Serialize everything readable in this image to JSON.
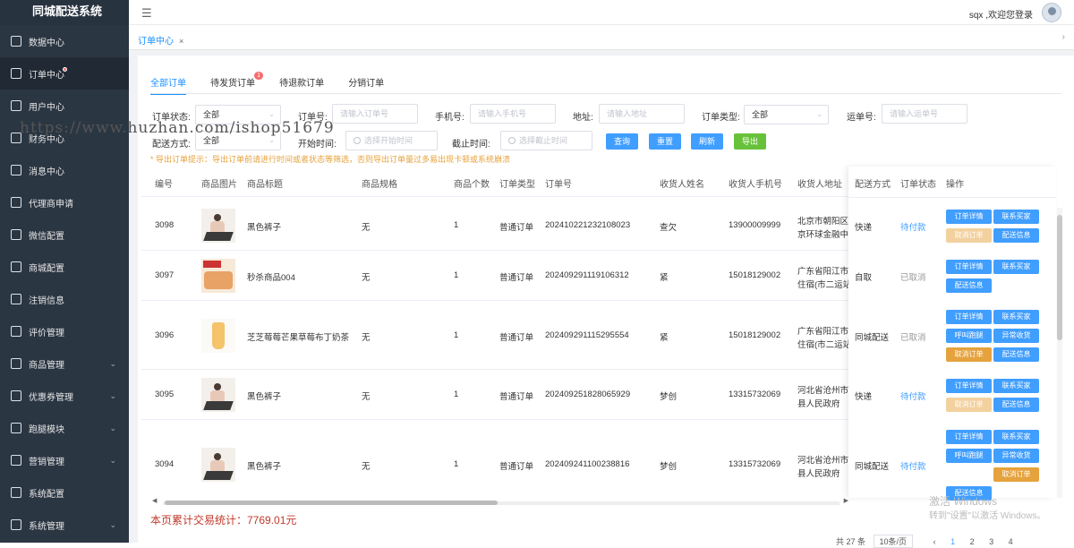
{
  "app_title": "同城配送系统",
  "sidebar": {
    "items": [
      {
        "label": "数据中心",
        "icon": "dashboard-icon",
        "has_arrow": false
      },
      {
        "label": "订单中心",
        "icon": "order-icon",
        "has_arrow": false,
        "active": true,
        "dot": true
      },
      {
        "label": "用户中心",
        "icon": "user-icon",
        "has_arrow": false
      },
      {
        "label": "财务中心",
        "icon": "finance-icon",
        "has_arrow": false
      },
      {
        "label": "消息中心",
        "icon": "message-icon",
        "has_arrow": false
      },
      {
        "label": "代理商申请",
        "icon": "send-icon",
        "has_arrow": false
      },
      {
        "label": "微信配置",
        "icon": "wechat-icon",
        "has_arrow": false
      },
      {
        "label": "商城配置",
        "icon": "cube-icon",
        "has_arrow": false
      },
      {
        "label": "注销信息",
        "icon": "document-icon",
        "has_arrow": false
      },
      {
        "label": "评价管理",
        "icon": "comment-icon",
        "has_arrow": false
      },
      {
        "label": "商品管理",
        "icon": "goods-icon",
        "has_arrow": true
      },
      {
        "label": "优惠券管理",
        "icon": "coupon-icon",
        "has_arrow": true
      },
      {
        "label": "跑腿模块",
        "icon": "runner-icon",
        "has_arrow": true
      },
      {
        "label": "营销管理",
        "icon": "marketing-icon",
        "has_arrow": true
      },
      {
        "label": "系统配置",
        "icon": "settings-list-icon",
        "has_arrow": false
      },
      {
        "label": "系统管理",
        "icon": "gear-icon",
        "has_arrow": true
      }
    ]
  },
  "header": {
    "welcome": "sqx ,欢迎您登录"
  },
  "page_tab": {
    "label": "订单中心",
    "close": "×"
  },
  "subtabs": [
    {
      "label": "全部订单",
      "active": true
    },
    {
      "label": "待发货订单",
      "badge": "1"
    },
    {
      "label": "待退款订单"
    },
    {
      "label": "分销订单"
    }
  ],
  "filters": {
    "order_status_label": "订单状态:",
    "order_status_value": "全部",
    "order_no_label": "订单号:",
    "order_no_placeholder": "请输入订单号",
    "phone_label": "手机号:",
    "phone_placeholder": "请输入手机号",
    "address_label": "地址:",
    "address_placeholder": "请输入地址",
    "order_type_label": "订单类型:",
    "order_type_value": "全部",
    "waybill_label": "运单号:",
    "waybill_placeholder": "请输入运单号",
    "delivery_label": "配送方式:",
    "delivery_value": "全部",
    "start_label": "开始时间:",
    "start_placeholder": "选择开始时间",
    "end_label": "截止时间:",
    "end_placeholder": "选择截止时间",
    "btn_query": "查询",
    "btn_reset": "重置",
    "btn_refresh": "刷新",
    "btn_export": "导出"
  },
  "tip": "* 导出订单提示：导出订单前请进行时间或者状态等筛选，否则导出订单量过多易出现卡顿或系统崩溃",
  "table": {
    "headers": [
      "编号",
      "商品图片",
      "商品标题",
      "商品规格",
      "商品个数",
      "订单类型",
      "订单号",
      "收货人姓名",
      "收货人手机号",
      "收货人地址",
      "配送方式",
      "订单状态",
      "操作"
    ],
    "rows": [
      {
        "id": "3098",
        "title": "黑色裤子",
        "spec": "无",
        "count": "1",
        "type": "普通订单",
        "order_no": "202410221232108023",
        "name": "查欠",
        "phone": "13900009999",
        "addr1": "北京市朝阳区",
        "addr2": "京环球金融中心",
        "delivery": "快递",
        "status": "待付款",
        "image": "figure"
      },
      {
        "id": "3097",
        "title": "秒杀商品004",
        "spec": "无",
        "count": "1",
        "type": "普通订单",
        "order_no": "202409291119106312",
        "name": "紧",
        "phone": "15018129002",
        "addr1": "广东省阳江市",
        "addr2": "住宿(市二运站",
        "delivery": "自取",
        "status": "已取消",
        "image": "food"
      },
      {
        "id": "3096",
        "title": "芝芝莓莓芒果草莓布丁奶茶",
        "spec": "无",
        "count": "1",
        "type": "普通订单",
        "order_no": "202409291115295554",
        "name": "紧",
        "phone": "15018129002",
        "addr1": "广东省阳江市",
        "addr2": "住宿(市二运站",
        "delivery": "同城配送",
        "status": "已取消",
        "image": "drink"
      },
      {
        "id": "3095",
        "title": "黑色裤子",
        "spec": "无",
        "count": "1",
        "type": "普通订单",
        "order_no": "202409251828065929",
        "name": "梦创",
        "phone": "13315732069",
        "addr1": "河北省沧州市",
        "addr2": "县人民政府",
        "delivery": "快递",
        "status": "待付款",
        "image": "figure"
      },
      {
        "id": "3094",
        "title": "黑色裤子",
        "spec": "无",
        "count": "1",
        "type": "普通订单",
        "order_no": "202409241100238816",
        "name": "梦创",
        "phone": "13315732069",
        "addr1": "河北省沧州市",
        "addr2": "县人民政府",
        "delivery": "同城配送",
        "status": "待付款",
        "image": "figure"
      }
    ]
  },
  "ops": {
    "detail": "订单详情",
    "contact_buyer": "联系买家",
    "cancel_order": "取消订单",
    "delivery_info": "配送信息",
    "call_runner": "呼叫跑腿",
    "abnormal_receipt": "异常收货"
  },
  "stats": "本页累计交易统计：7769.01元",
  "pager": {
    "total": "共 27 条",
    "size": "10条/页",
    "pages": [
      "1",
      "2",
      "3",
      "4"
    ]
  },
  "watermark": {
    "line1": "激活 Windows",
    "line2": "转到\"设置\"以激活 Windows。",
    "url": "https://www.huzhan.com/ishop51679"
  }
}
